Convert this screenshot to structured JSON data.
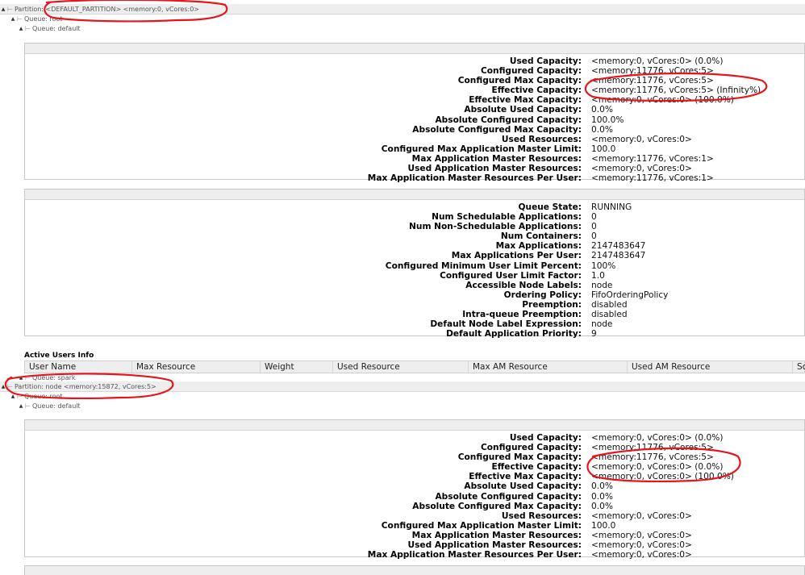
{
  "tree": {
    "partition1": "Partition: <DEFAULT_PARTITION> <memory:0, vCores:0>",
    "queue_root_1": "Queue: root",
    "queue_default_1": "Queue: default",
    "queue_spark": "Queue: spark",
    "partition2": "Partition: node <memory:15872, vCores:5>",
    "queue_root_2": "Queue: root",
    "queue_default_2": "Queue: default"
  },
  "panel1": {
    "rows": [
      {
        "label": "Used Capacity:",
        "value": "<memory:0, vCores:0> (0.0%)"
      },
      {
        "label": "Configured Capacity:",
        "value": "<memory:11776, vCores:5>"
      },
      {
        "label": "Configured Max Capacity:",
        "value": "<memory:11776, vCores:5>"
      },
      {
        "label": "Effective Capacity:",
        "value": "<memory:11776, vCores:5> (Infinity%)"
      },
      {
        "label": "Effective Max Capacity:",
        "value": "<memory:0, vCores:0> (100.0%)"
      },
      {
        "label": "Absolute Used Capacity:",
        "value": "0.0%"
      },
      {
        "label": "Absolute Configured Capacity:",
        "value": "100.0%"
      },
      {
        "label": "Absolute Configured Max Capacity:",
        "value": "0.0%"
      },
      {
        "label": "Used Resources:",
        "value": "<memory:0, vCores:0>"
      },
      {
        "label": "Configured Max Application Master Limit:",
        "value": "100.0"
      },
      {
        "label": "Max Application Master Resources:",
        "value": "<memory:11776, vCores:1>"
      },
      {
        "label": "Used Application Master Resources:",
        "value": "<memory:0, vCores:0>"
      },
      {
        "label": "Max Application Master Resources Per User:",
        "value": "<memory:11776, vCores:1>"
      }
    ]
  },
  "panel2": {
    "rows": [
      {
        "label": "Queue State:",
        "value": "RUNNING"
      },
      {
        "label": "Num Schedulable Applications:",
        "value": "0"
      },
      {
        "label": "Num Non-Schedulable Applications:",
        "value": "0"
      },
      {
        "label": "Num Containers:",
        "value": "0"
      },
      {
        "label": "Max Applications:",
        "value": "2147483647"
      },
      {
        "label": "Max Applications Per User:",
        "value": "2147483647"
      },
      {
        "label": "Configured Minimum User Limit Percent:",
        "value": "100%"
      },
      {
        "label": "Configured User Limit Factor:",
        "value": "1.0"
      },
      {
        "label": "Accessible Node Labels:",
        "value": "node"
      },
      {
        "label": "Ordering Policy:",
        "value": "FifoOrderingPolicy"
      },
      {
        "label": "Preemption:",
        "value": "disabled"
      },
      {
        "label": "Intra-queue Preemption:",
        "value": "disabled"
      },
      {
        "label": "Default Node Label Expression:",
        "value": "node"
      },
      {
        "label": "Default Application Priority:",
        "value": "9"
      }
    ]
  },
  "active_users": {
    "title": "Active Users Info",
    "columns": [
      "User Name",
      "Max Resource",
      "Weight",
      "Used Resource",
      "Max AM Resource",
      "Used AM Resource",
      "Sc"
    ]
  },
  "panel3": {
    "rows": [
      {
        "label": "Used Capacity:",
        "value": "<memory:0, vCores:0> (0.0%)"
      },
      {
        "label": "Configured Capacity:",
        "value": "<memory:11776, vCores:5>"
      },
      {
        "label": "Configured Max Capacity:",
        "value": "<memory:11776, vCores:5>"
      },
      {
        "label": "Effective Capacity:",
        "value": "<memory:0, vCores:0> (0.0%)"
      },
      {
        "label": "Effective Max Capacity:",
        "value": "<memory:0, vCores:0> (100.0%)"
      },
      {
        "label": "Absolute Used Capacity:",
        "value": "0.0%"
      },
      {
        "label": "Absolute Configured Capacity:",
        "value": "0.0%"
      },
      {
        "label": "Absolute Configured Max Capacity:",
        "value": "0.0%"
      },
      {
        "label": "Used Resources:",
        "value": "<memory:0, vCores:0>"
      },
      {
        "label": "Configured Max Application Master Limit:",
        "value": "100.0"
      },
      {
        "label": "Max Application Master Resources:",
        "value": "<memory:0, vCores:0>"
      },
      {
        "label": "Used Application Master Resources:",
        "value": "<memory:0, vCores:0>"
      },
      {
        "label": "Max Application Master Resources Per User:",
        "value": "<memory:0, vCores:0>"
      }
    ]
  },
  "colors": {
    "annotation": "#e8141c",
    "panel_header": "#eeeeee",
    "border": "#c8c8c8"
  },
  "icons": {
    "expand": "triangle-down-icon",
    "tree_branch": "tree-branch-icon"
  }
}
